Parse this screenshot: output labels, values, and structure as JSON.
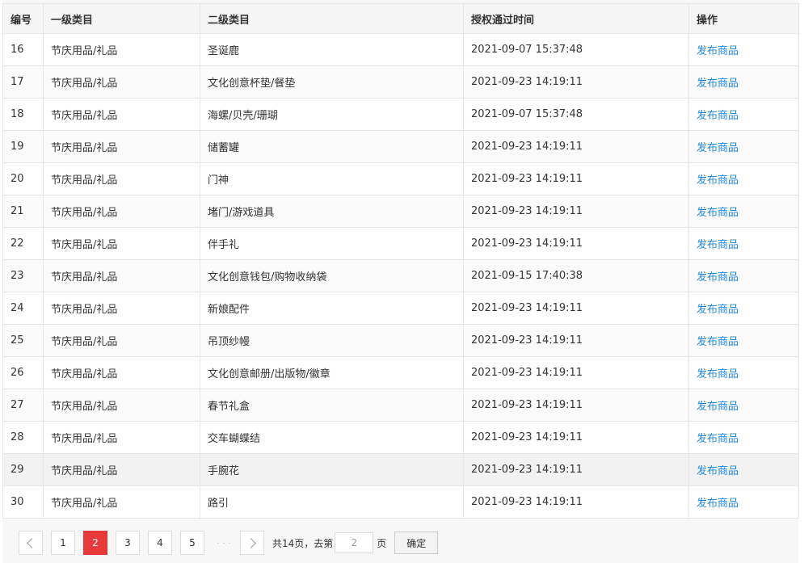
{
  "table": {
    "headers": [
      "编号",
      "一级类目",
      "二级类目",
      "授权通过时间",
      "操作"
    ],
    "rows": [
      {
        "id": "16",
        "cat1": "节庆用品/礼品",
        "cat2": "圣诞鹿",
        "time": "2021-09-07 15:37:48",
        "action": "发布商品"
      },
      {
        "id": "17",
        "cat1": "节庆用品/礼品",
        "cat2": "文化创意杯垫/餐垫",
        "time": "2021-09-23 14:19:11",
        "action": "发布商品"
      },
      {
        "id": "18",
        "cat1": "节庆用品/礼品",
        "cat2": "海螺/贝壳/珊瑚",
        "time": "2021-09-07 15:37:48",
        "action": "发布商品"
      },
      {
        "id": "19",
        "cat1": "节庆用品/礼品",
        "cat2": "储蓄罐",
        "time": "2021-09-23 14:19:11",
        "action": "发布商品"
      },
      {
        "id": "20",
        "cat1": "节庆用品/礼品",
        "cat2": "门神",
        "time": "2021-09-23 14:19:11",
        "action": "发布商品"
      },
      {
        "id": "21",
        "cat1": "节庆用品/礼品",
        "cat2": "堵门/游戏道具",
        "time": "2021-09-23 14:19:11",
        "action": "发布商品"
      },
      {
        "id": "22",
        "cat1": "节庆用品/礼品",
        "cat2": "伴手礼",
        "time": "2021-09-23 14:19:11",
        "action": "发布商品"
      },
      {
        "id": "23",
        "cat1": "节庆用品/礼品",
        "cat2": "文化创意钱包/购物收纳袋",
        "time": "2021-09-15 17:40:38",
        "action": "发布商品"
      },
      {
        "id": "24",
        "cat1": "节庆用品/礼品",
        "cat2": "新娘配件",
        "time": "2021-09-23 14:19:11",
        "action": "发布商品"
      },
      {
        "id": "25",
        "cat1": "节庆用品/礼品",
        "cat2": "吊顶纱幔",
        "time": "2021-09-23 14:19:11",
        "action": "发布商品"
      },
      {
        "id": "26",
        "cat1": "节庆用品/礼品",
        "cat2": "文化创意邮册/出版物/徽章",
        "time": "2021-09-23 14:19:11",
        "action": "发布商品"
      },
      {
        "id": "27",
        "cat1": "节庆用品/礼品",
        "cat2": "春节礼盒",
        "time": "2021-09-23 14:19:11",
        "action": "发布商品"
      },
      {
        "id": "28",
        "cat1": "节庆用品/礼品",
        "cat2": "交车蝴蝶结",
        "time": "2021-09-23 14:19:11",
        "action": "发布商品"
      },
      {
        "id": "29",
        "cat1": "节庆用品/礼品",
        "cat2": "手腕花",
        "time": "2021-09-23 14:19:11",
        "action": "发布商品"
      },
      {
        "id": "30",
        "cat1": "节庆用品/礼品",
        "cat2": "路引",
        "time": "2021-09-23 14:19:11",
        "action": "发布商品"
      }
    ]
  },
  "pagination": {
    "pages": [
      "1",
      "2",
      "3",
      "4",
      "5"
    ],
    "current": "2",
    "ellipsis": "· · ·",
    "total_text": "共14页，去第",
    "goto_value": "2",
    "page_suffix": "页",
    "confirm_label": "确定"
  },
  "colors": {
    "link": "#1e88e5",
    "active_page": "#e83a3a"
  }
}
